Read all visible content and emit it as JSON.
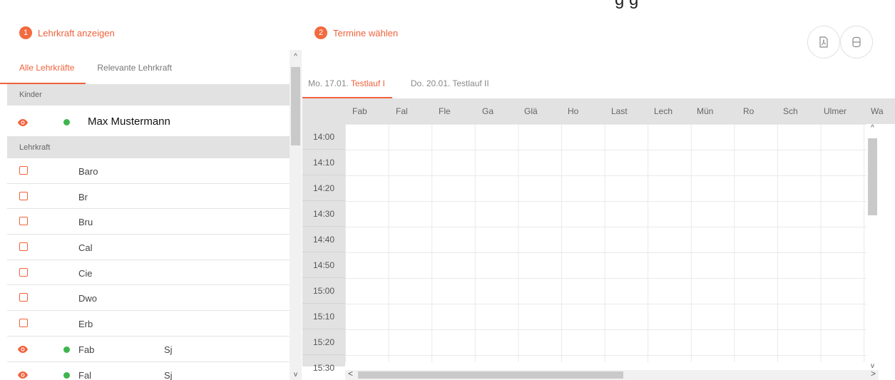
{
  "top_fragment": "g   g",
  "left": {
    "step_number": "1",
    "step_title": "Lehrkraft anzeigen",
    "tabs": [
      {
        "label": "Alle Lehrkräfte",
        "active": true
      },
      {
        "label": "Relevante Lehrkraft",
        "active": false
      }
    ],
    "sections": {
      "children": "Kinder",
      "teachers": "Lehrkraft"
    },
    "child": {
      "name": "Max Mustermann"
    },
    "teachers": [
      {
        "name": "Baro",
        "sub": ""
      },
      {
        "name": "Br",
        "sub": ""
      },
      {
        "name": "Bru",
        "sub": ""
      },
      {
        "name": "Cal",
        "sub": ""
      },
      {
        "name": "Cie",
        "sub": ""
      },
      {
        "name": "Dwo",
        "sub": ""
      },
      {
        "name": "Erb",
        "sub": ""
      },
      {
        "name": "Fab",
        "sub": "Sj"
      },
      {
        "name": "Fal",
        "sub": "Sj"
      }
    ],
    "scroll": {
      "up": "^",
      "down": "v"
    }
  },
  "right": {
    "step_number": "2",
    "step_title": "Termine wählen",
    "day_tabs": [
      {
        "prefix": "Mo. 17.01. ",
        "highlight": "Testlauf I",
        "active": true
      },
      {
        "prefix": "Do. 20.01. Testlauf II",
        "highlight": "",
        "active": false
      }
    ],
    "columns": [
      "Fab",
      "Fal",
      "Fle",
      "Ga",
      "Glä",
      "Ho",
      "Last",
      "Lech",
      "Mün",
      "Ro",
      "Sch",
      "Ulmer",
      "Wa"
    ],
    "times": [
      "14:00",
      "14:10",
      "14:20",
      "14:30",
      "14:40",
      "14:50",
      "15:00",
      "15:10",
      "15:20",
      "15:30"
    ],
    "scroll": {
      "up": "^",
      "down": "v",
      "left": "<",
      "right": ">"
    }
  },
  "colors": {
    "accent": "#f0623c",
    "status_green": "#3eb54c",
    "header_gray": "#e2e2e2"
  },
  "icons": [
    "eye-icon",
    "status-dot-icon",
    "checkbox-icon",
    "pdf-icon",
    "print-icon"
  ]
}
